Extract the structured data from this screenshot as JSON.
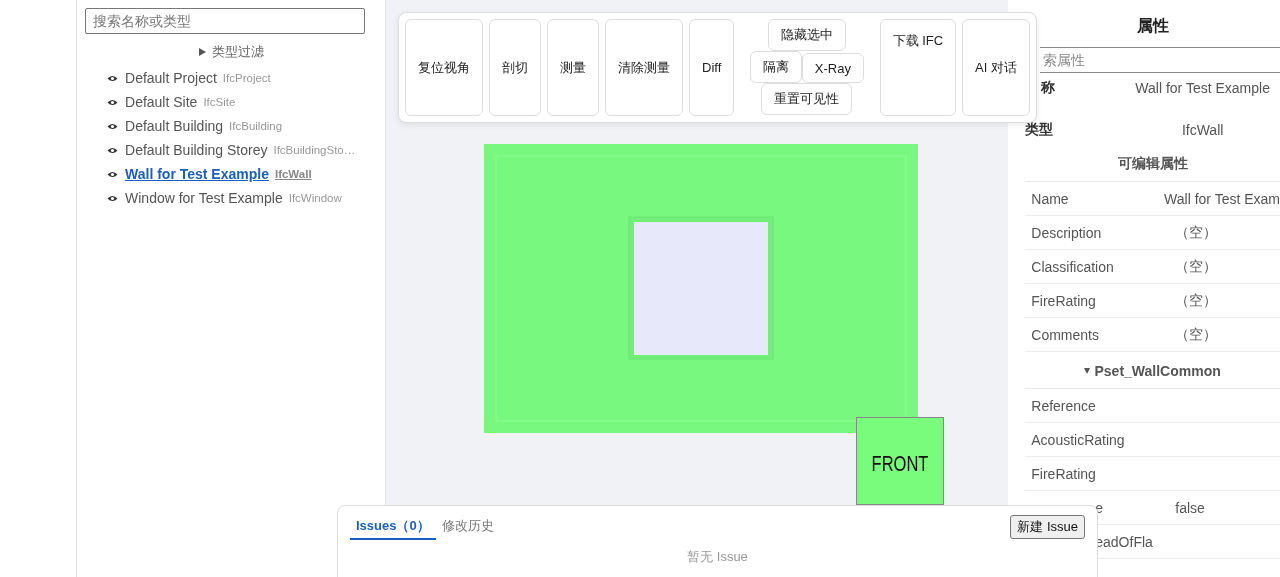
{
  "left_panel": {
    "search": {
      "placeholder": "搜索名称或类型"
    },
    "type_filter": {
      "label": "类型过滤",
      "expanded": false
    },
    "tree": [
      {
        "name": "Default Project",
        "type": "IfcProject",
        "selected": false
      },
      {
        "name": "Default Site",
        "type": "IfcSite",
        "selected": false
      },
      {
        "name": "Default Building",
        "type": "IfcBuilding",
        "selected": false
      },
      {
        "name": "Default Building Storey",
        "type": "IfcBuildingSto…",
        "selected": false
      },
      {
        "name": "Wall for Test Example",
        "type": "IfcWall",
        "selected": true
      },
      {
        "name": "Window for Test Example",
        "type": "IfcWindow",
        "selected": false
      }
    ]
  },
  "toolbar": {
    "buttons": [
      {
        "label": "复位视角",
        "kind": "tall"
      },
      {
        "label": "剖切",
        "kind": "tall"
      },
      {
        "label": "测量",
        "kind": "tall"
      },
      {
        "label": "清除测量",
        "kind": "tall"
      },
      {
        "label": "Diff",
        "kind": "tall"
      },
      {
        "label": "隐藏选中",
        "kind": "small"
      },
      {
        "label": "隔离",
        "kind": "small"
      },
      {
        "label": "X-Ray",
        "kind": "small"
      },
      {
        "label": "重置可见性",
        "kind": "small"
      },
      {
        "label": "下载 IFC",
        "kind": "top"
      },
      {
        "label": "AI 对话",
        "kind": "tall"
      }
    ]
  },
  "viewport": {
    "view_cube": {
      "label": "FRONT"
    }
  },
  "properties": {
    "title": "属性",
    "search": {
      "placeholder": "索属性"
    },
    "header_rows": [
      {
        "label": "称",
        "value": "Wall for Test Example",
        "kind": "cut"
      },
      {
        "label": "类型",
        "value": "IfcWall",
        "kind": "full"
      }
    ],
    "sections": [
      {
        "title": "可编辑属性",
        "kind": "plain",
        "rows": [
          {
            "label": "Name",
            "value": "Wall for Test Exam",
            "kind": "full"
          },
          {
            "label": "Description",
            "value": "（空）",
            "kind": "full"
          },
          {
            "label": "Classification",
            "value": "（空）",
            "kind": "full"
          },
          {
            "label": "FireRating",
            "value": "（空）",
            "kind": "full"
          },
          {
            "label": "Comments",
            "value": "（空）",
            "kind": "full"
          }
        ]
      },
      {
        "title": "Pset_WallCommon",
        "kind": "collapsible",
        "expanded": true,
        "rows": [
          {
            "label": "Reference",
            "kind": "full"
          },
          {
            "label": "AcousticRating",
            "kind": "full"
          },
          {
            "label": "FireRating",
            "kind": "full"
          },
          {
            "label": "e",
            "value": "false",
            "kind": "cut"
          },
          {
            "label": "eadOfFla",
            "kind": "cut"
          }
        ]
      }
    ]
  },
  "issues": {
    "tabs": [
      {
        "label": "Issues（0）",
        "selected": true
      },
      {
        "label": "修改历史",
        "selected": false
      }
    ],
    "new_button": "新建 Issue",
    "empty_text": "暂无 Issue"
  }
}
